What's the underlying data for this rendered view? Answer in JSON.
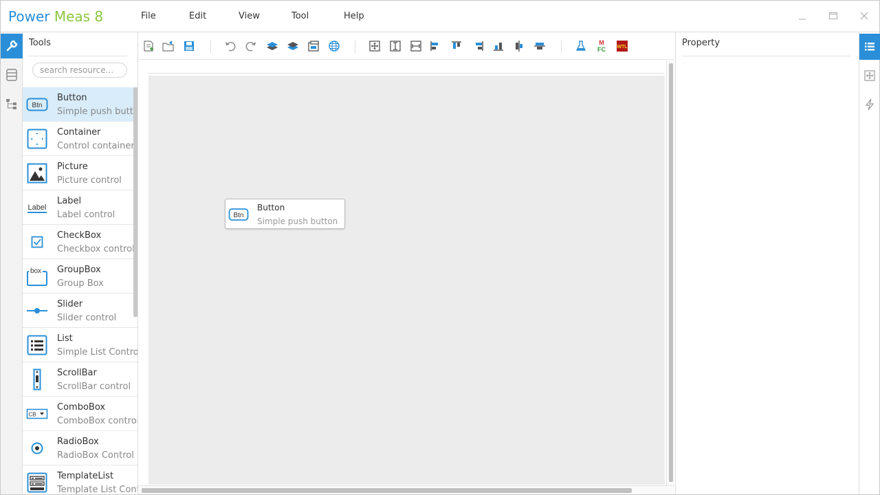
{
  "app": {
    "title_part1": "Power",
    "title_part2": "Meas 8",
    "accent_color": "#2a8fd8",
    "secondary_color": "#8cc63f"
  },
  "menu": [
    "File",
    "Edit",
    "View",
    "Tool",
    "Help"
  ],
  "window_controls": [
    "minimize-icon",
    "maximize-icon",
    "close-icon"
  ],
  "left_rail": {
    "items": [
      {
        "icon": "wrench-icon",
        "active": true
      },
      {
        "icon": "database-icon",
        "active": false
      },
      {
        "icon": "tree-icon",
        "active": false
      }
    ]
  },
  "tools_panel": {
    "title": "Tools",
    "search_placeholder": "search resource...",
    "items": [
      {
        "name": "Button",
        "desc": "Simple push button",
        "icon": "button-icon",
        "selected": true
      },
      {
        "name": "Container",
        "desc": "Control container",
        "icon": "container-icon"
      },
      {
        "name": "Picture",
        "desc": "Picture control",
        "icon": "picture-icon"
      },
      {
        "name": "Label",
        "desc": "Label control",
        "icon": "label-icon"
      },
      {
        "name": "CheckBox",
        "desc": "Checkbox control",
        "icon": "checkbox-icon"
      },
      {
        "name": "GroupBox",
        "desc": "Group Box",
        "icon": "groupbox-icon"
      },
      {
        "name": "Slider",
        "desc": "Slider control",
        "icon": "slider-icon"
      },
      {
        "name": "List",
        "desc": "Simple List Control",
        "icon": "list-icon"
      },
      {
        "name": "ScrollBar",
        "desc": "ScrollBar control",
        "icon": "scrollbar-icon"
      },
      {
        "name": "ComboBox",
        "desc": "ComboBox control",
        "icon": "combobox-icon"
      },
      {
        "name": "RadioBox",
        "desc": "RadioBox Control",
        "icon": "radiobox-icon"
      },
      {
        "name": "TemplateList",
        "desc": "Template List Control",
        "icon": "templatelist-icon"
      }
    ],
    "icon_labels": {
      "button": "Btn",
      "label": "Label",
      "groupbox": "box",
      "combobox": "CB"
    }
  },
  "toolbar": {
    "buttons": [
      "new-page-icon",
      "open-export-icon",
      "save-icon",
      "undo-icon",
      "redo-icon",
      "bring-front-icon",
      "send-back-icon",
      "window-icon",
      "globe-icon",
      "center-both-icon",
      "center-vertical-icon",
      "center-horizontal-icon",
      "align-left-icon",
      "align-top-icon",
      "align-right-icon",
      "align-bottom-icon",
      "distribute-horizontal-icon",
      "distribute-vertical-icon",
      "flask-icon",
      "mfc-icon",
      "wtl-icon"
    ],
    "badge_mfc_top": "M",
    "badge_mfc_bottom": "FC",
    "badge_wtl": "WTL"
  },
  "canvas": {
    "placed_control": {
      "name": "Button",
      "desc": "Simple push button",
      "icon_label": "Btn"
    }
  },
  "property_panel": {
    "title": "Property"
  },
  "right_rail": {
    "items": [
      {
        "icon": "property-list-icon",
        "active": true
      },
      {
        "icon": "layout-icon",
        "active": false
      },
      {
        "icon": "event-bolt-icon",
        "active": false
      }
    ]
  }
}
